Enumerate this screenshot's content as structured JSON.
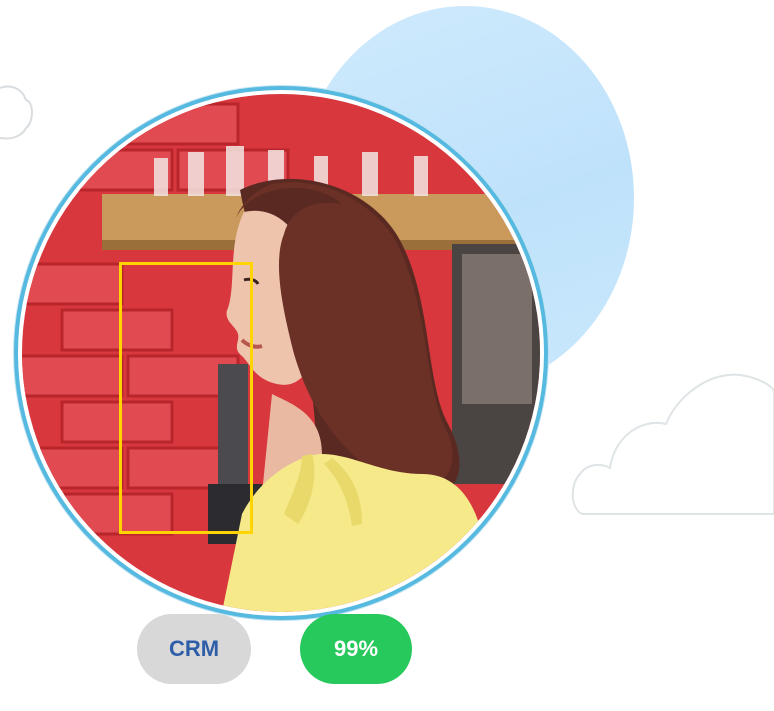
{
  "badges": {
    "category_label": "CRM",
    "score_label": "99%"
  },
  "colors": {
    "ring": "#56b9e0",
    "detection_box": "#ffd400",
    "category_badge_bg": "#d8d8d8",
    "category_badge_text": "#2f5ea8",
    "score_badge_bg": "#27c95c",
    "score_badge_text": "#ffffff"
  }
}
